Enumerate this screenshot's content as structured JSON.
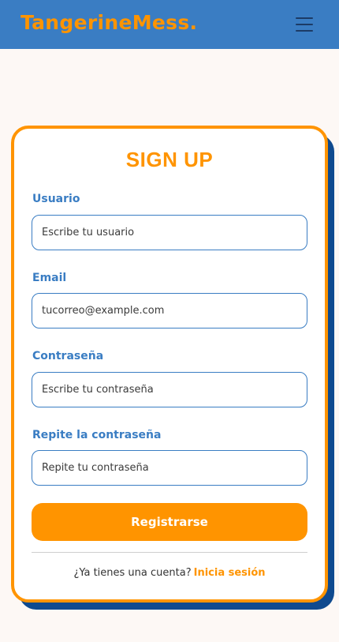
{
  "header": {
    "brand": "TangerineMess.",
    "menu_icon": "hamburger-menu-icon"
  },
  "form": {
    "title": "SIGN UP",
    "fields": [
      {
        "label": "Usuario",
        "placeholder": "Escribe tu usuario",
        "value": ""
      },
      {
        "label": "Email",
        "placeholder": "tucorreo@example.com",
        "value": ""
      },
      {
        "label": "Contraseña",
        "placeholder": "Escribe tu contraseña",
        "value": ""
      },
      {
        "label": "Repite la contraseña",
        "placeholder": "Repite tu contraseña",
        "value": ""
      }
    ],
    "submit_label": "Registrarse",
    "footer_text": "¿Ya tienes una cuenta?",
    "footer_link": "Inicia sesión"
  },
  "colors": {
    "accent": "#ff9400",
    "primary": "#3a7dc3",
    "shadow": "#0f4a8f",
    "background": "#fdf8f5"
  }
}
